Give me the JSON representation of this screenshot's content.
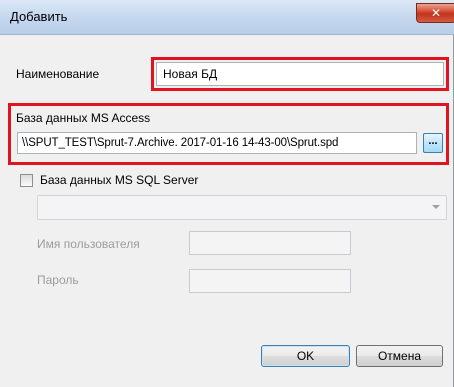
{
  "window": {
    "title": "Добавить",
    "close_glyph": "✕"
  },
  "name_field": {
    "label": "Наименование",
    "value": "Новая БД"
  },
  "access_section": {
    "label": "База данных MS Access",
    "path_value": "\\\\SPUT_TEST\\Sprut-7.Archive. 2017-01-16  14-43-00\\Sprut.spd",
    "browse_label": "..."
  },
  "sql_section": {
    "checkbox_label": "База данных MS SQL Server",
    "checked": false,
    "server_value": "",
    "username_label": "Имя пользователя",
    "username_value": "",
    "password_label": "Пароль",
    "password_value": ""
  },
  "buttons": {
    "ok_label": "OK",
    "cancel_label": "Отмена"
  },
  "colors": {
    "highlight": "#e0141e",
    "close_button": "#d2452c",
    "titlebar": "#c6d8ef"
  },
  "icons": {
    "close": "close-icon",
    "dropdown": "chevron-down-icon"
  }
}
